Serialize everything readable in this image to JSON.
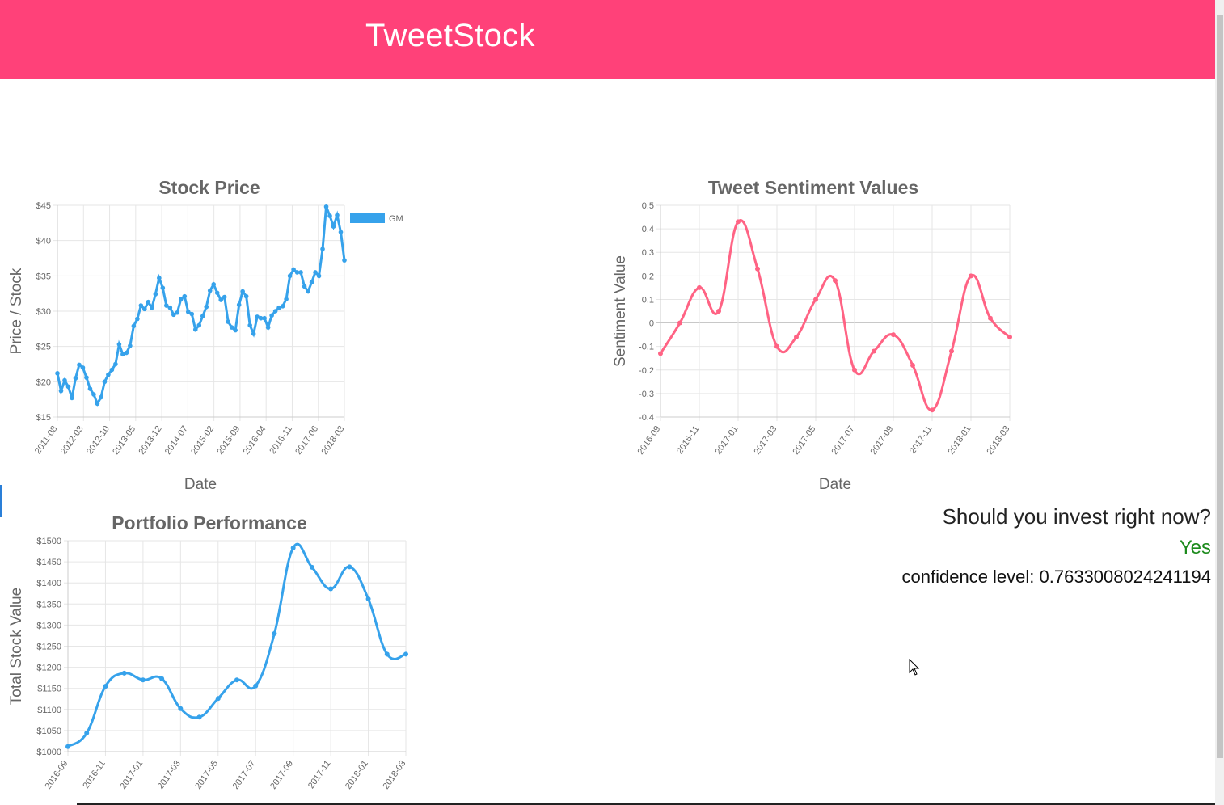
{
  "app": {
    "title": "TweetStock"
  },
  "colors": {
    "header": "#ff4179",
    "blue": "#36a2eb",
    "pink": "#ff6384",
    "yes": "#1c8a1c"
  },
  "invest": {
    "question": "Should you invest right now?",
    "answer": "Yes",
    "confidence_label": "confidence level: 0.7633008024241194"
  },
  "chart_data": [
    {
      "id": "stock",
      "type": "line",
      "title": "Stock Price",
      "xlabel": "Date",
      "ylabel": "Price / Stock",
      "ylim": [
        15,
        45
      ],
      "yticks": [
        15,
        20,
        25,
        30,
        35,
        40,
        45
      ],
      "ytick_prefix": "$",
      "xticks": [
        "2011-08",
        "2012-03",
        "2012-10",
        "2013-05",
        "2013-12",
        "2014-07",
        "2015-02",
        "2015-09",
        "2016-04",
        "2016-11",
        "2017-06",
        "2018-03"
      ],
      "legend": "GM",
      "legend_position": "right",
      "series": [
        {
          "name": "GM",
          "values": [
            21.2,
            18.7,
            20.2,
            19.3,
            17.7,
            20.5,
            22.4,
            22.0,
            20.6,
            19.0,
            18.2,
            16.9,
            17.8,
            20.0,
            21.0,
            21.7,
            22.5,
            25.3,
            23.9,
            24.1,
            25.1,
            27.9,
            28.9,
            30.8,
            30.3,
            31.3,
            30.5,
            32.4,
            34.7,
            33.3,
            30.8,
            30.5,
            29.5,
            29.8,
            31.7,
            32.1,
            29.9,
            29.6,
            27.4,
            28.0,
            29.3,
            30.6,
            32.9,
            33.8,
            32.6,
            31.6,
            32.0,
            28.5,
            27.7,
            27.3,
            30.9,
            32.8,
            32.1,
            28.0,
            26.8,
            29.2,
            29.0,
            29.0,
            27.7,
            29.4,
            30.0,
            30.5,
            30.7,
            31.7,
            35.0,
            35.9,
            35.5,
            35.5,
            33.5,
            32.8,
            34.1,
            35.5,
            35.0,
            38.8,
            44.8,
            43.5,
            42.0,
            43.6,
            41.2,
            37.2
          ]
        }
      ],
      "grid": true
    },
    {
      "id": "sentiment",
      "type": "line",
      "title": "Tweet Sentiment Values",
      "xlabel": "Date",
      "ylabel": "Sentiment Value",
      "ylim": [
        -0.4,
        0.5
      ],
      "yticks": [
        -0.4,
        -0.3,
        -0.2,
        -0.1,
        0,
        0.1,
        0.2,
        0.3,
        0.4,
        0.5
      ],
      "xticks": [
        "2016-09",
        "2016-11",
        "2017-01",
        "2017-03",
        "2017-05",
        "2017-07",
        "2017-09",
        "2017-11",
        "2018-01",
        "2018-03"
      ],
      "series": [
        {
          "values": [
            -0.13,
            0.0,
            0.15,
            0.05,
            0.43,
            0.23,
            -0.1,
            -0.06,
            0.1,
            0.18,
            -0.2,
            -0.12,
            -0.05,
            -0.18,
            -0.37,
            -0.12,
            0.2,
            0.02,
            -0.06
          ]
        }
      ],
      "grid": true
    },
    {
      "id": "portfolio",
      "type": "line",
      "title": "Portfolio Performance",
      "xlabel": "",
      "ylabel": "Total Stock Value",
      "ylim": [
        1000,
        1500
      ],
      "yticks": [
        1000,
        1050,
        1100,
        1150,
        1200,
        1250,
        1300,
        1350,
        1400,
        1450,
        1500
      ],
      "ytick_prefix": "$",
      "xticks": [
        "2016-09",
        "2016-11",
        "2017-01",
        "2017-03",
        "2017-05",
        "2017-07",
        "2017-09",
        "2017-11",
        "2018-01",
        "2018-03"
      ],
      "series": [
        {
          "values": [
            1012,
            1044,
            1155,
            1186,
            1170,
            1173,
            1102,
            1082,
            1126,
            1170,
            1156,
            1280,
            1483,
            1437,
            1386,
            1438,
            1362,
            1231,
            1231
          ]
        }
      ],
      "grid": true
    }
  ]
}
